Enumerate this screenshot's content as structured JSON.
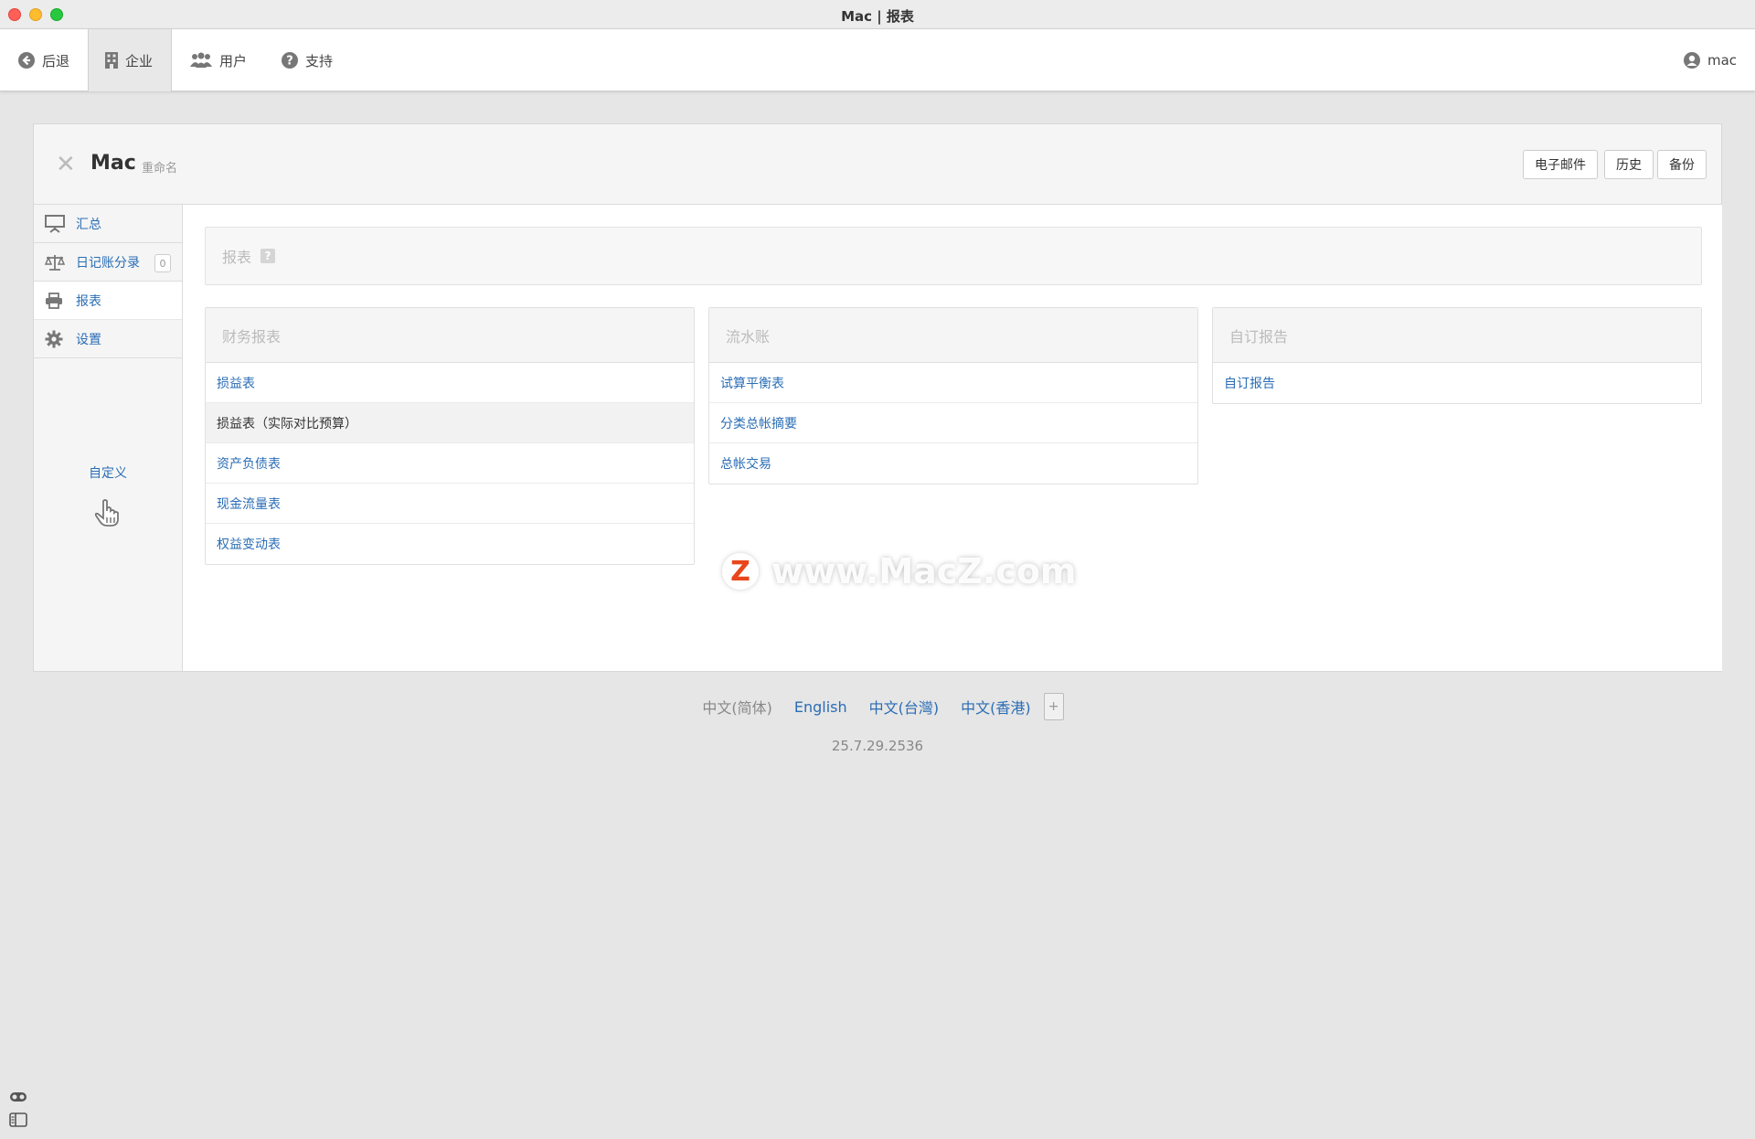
{
  "window": {
    "title": "Mac | 报表"
  },
  "nav": {
    "back": "后退",
    "company": "企业",
    "users": "用户",
    "support": "支持",
    "user_name": "mac"
  },
  "header": {
    "company_name": "Mac",
    "rename": "重命名",
    "email_button": "电子邮件",
    "history_button": "历史",
    "backup_button": "备份"
  },
  "sidebar": {
    "items": [
      {
        "label": "汇总",
        "icon": "presentation-icon"
      },
      {
        "label": "日记账分录",
        "icon": "balance-scale-icon",
        "badge": "0"
      },
      {
        "label": "报表",
        "icon": "printer-icon"
      },
      {
        "label": "设置",
        "icon": "gear-icon"
      }
    ],
    "customize": "自定义"
  },
  "main": {
    "section_title": "报表",
    "help": "?",
    "cards": [
      {
        "title": "财务报表",
        "rows": [
          "损益表",
          "损益表（实际对比预算）",
          "资产负债表",
          "现金流量表",
          "权益变动表"
        ]
      },
      {
        "title": "流水账",
        "rows": [
          "试算平衡表",
          "分类总帐摘要",
          "总帐交易"
        ]
      },
      {
        "title": "自订报告",
        "rows": [
          "自订报告"
        ]
      }
    ]
  },
  "watermark": {
    "logo": "Z",
    "text": "www.MacZ.com"
  },
  "footer": {
    "languages": [
      "中文(简体)",
      "English",
      "中文(台灣)",
      "中文(香港)"
    ],
    "add_language": "+",
    "version": "25.7.29.2536"
  },
  "colors": {
    "link": "#2a6db5",
    "background": "#e6e6e6"
  }
}
